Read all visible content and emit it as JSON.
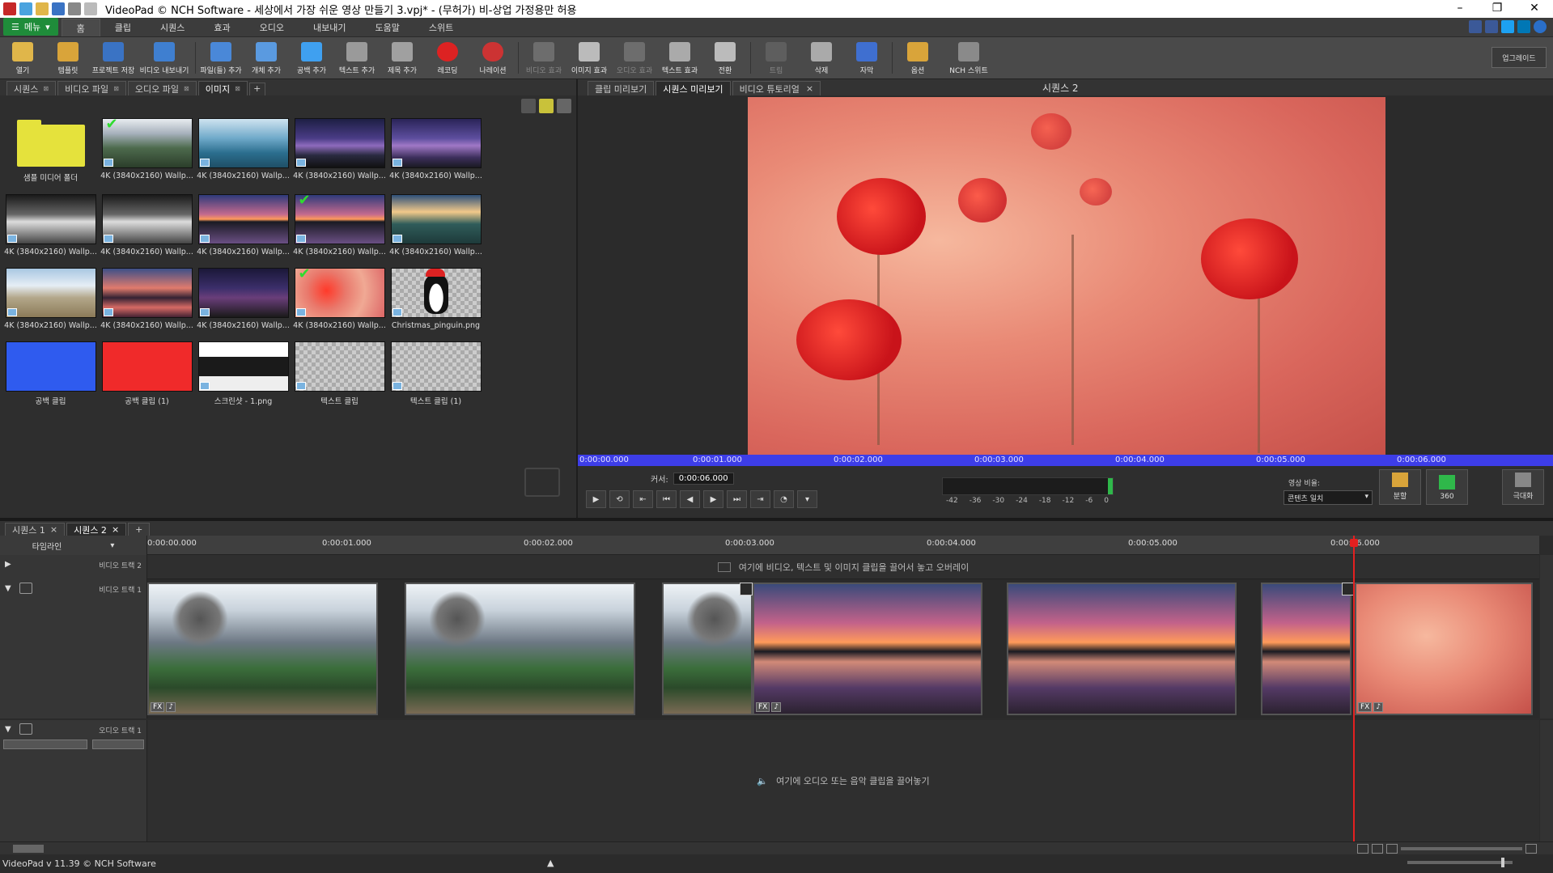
{
  "window": {
    "title": "VideoPad © NCH Software - 세상에서 가장 쉬운 영상 만들기 3.vpj* - (무허가) 비-상업 가정용만 허용",
    "minimize": "–",
    "restore": "❐",
    "close": "✕"
  },
  "menu": {
    "main_button": "메뉴",
    "tabs": [
      "홈",
      "클립",
      "시퀀스",
      "효과",
      "오디오",
      "내보내기",
      "도움말",
      "스위트"
    ]
  },
  "toolbar": {
    "items": [
      "열기",
      "템플릿",
      "프로젝트 저장",
      "비디오 내보내기",
      "파일(들) 추가",
      "개체 추가",
      "공백 추가",
      "텍스트 추가",
      "제목 추가",
      "레코딩",
      "나레이션",
      "비디오 효과",
      "이미지 효과",
      "오디오 효과",
      "텍스트 효과",
      "전환",
      "트림",
      "삭제",
      "자막",
      "옵션",
      "NCH 스위트"
    ],
    "upgrade": "업그레이드"
  },
  "bin": {
    "tabs": [
      "시퀀스",
      "비디오 파일",
      "오디오 파일",
      "이미지"
    ],
    "active_tab": "이미지",
    "plus": "+",
    "items": [
      {
        "caption": "샘플 미디어 폴더",
        "kind": "folder"
      },
      {
        "caption": "4K (3840x2160) Wallp...",
        "kind": "train",
        "checked": true
      },
      {
        "caption": "4K (3840x2160) Wallp...",
        "kind": "rock"
      },
      {
        "caption": "4K (3840x2160) Wallp...",
        "kind": "galaxy"
      },
      {
        "caption": "4K (3840x2160) Wallp...",
        "kind": "galaxy2"
      },
      {
        "caption": "4K (3840x2160) Wallp...",
        "kind": "bw"
      },
      {
        "caption": "4K (3840x2160) Wallp...",
        "kind": "bw"
      },
      {
        "caption": "4K (3840x2160) Wallp...",
        "kind": "lake"
      },
      {
        "caption": "4K (3840x2160) Wallp...",
        "kind": "lake",
        "checked": true
      },
      {
        "caption": "4K (3840x2160) Wallp...",
        "kind": "coast"
      },
      {
        "caption": "4K (3840x2160) Wallp...",
        "kind": "mountain"
      },
      {
        "caption": "4K (3840x2160) Wallp...",
        "kind": "dusk"
      },
      {
        "caption": "4K (3840x2160) Wallp...",
        "kind": "night"
      },
      {
        "caption": "4K (3840x2160) Wallp...",
        "kind": "poppy",
        "checked": true
      },
      {
        "caption": "Christmas_pinguin.png",
        "kind": "penguin"
      },
      {
        "caption": "공백 클립",
        "kind": "blue"
      },
      {
        "caption": "공백 클립 (1)",
        "kind": "red"
      },
      {
        "caption": "스크린샷 - 1.png",
        "kind": "screenshot"
      },
      {
        "caption": "텍스트 클립",
        "kind": "text"
      },
      {
        "caption": "텍스트 클립 (1)",
        "kind": "text"
      }
    ]
  },
  "preview": {
    "tabs": [
      "클립 미리보기",
      "시퀀스 미리보기",
      "비디오 튜토리얼"
    ],
    "active_tab": "시퀀스 미리보기",
    "sequence_name": "시퀀스 2",
    "time_marks": [
      "0:00:00.000",
      "0:00:01.000",
      "0:00:02.000",
      "0:00:03.000",
      "0:00:04.000",
      "0:00:05.000",
      "0:00:06.000"
    ],
    "cursor_label": "커서:",
    "cursor_value": "0:00:06.000",
    "meter_scale": [
      "-42",
      "-36",
      "-30",
      "-24",
      "-18",
      "-12",
      "-6",
      "0"
    ],
    "ratio_label": "영상 비율:",
    "ratio_value": "콘텐츠 일치",
    "split_label": "분할",
    "view360_label": "360",
    "fullscreen_label": "극대화"
  },
  "timeline": {
    "seq_tabs": [
      "시퀀스 1",
      "시퀀스 2"
    ],
    "active_seq": "시퀀스 2",
    "plus": "+",
    "timeline_label": "타임라인",
    "ruler": [
      "0:00:00.000",
      "0:00:01.000",
      "0:00:02.000",
      "0:00:03.000",
      "0:00:04.000",
      "0:00:05.000",
      "0:00:06.000"
    ],
    "overlay_hint": "여기에 비디오, 텍스트 및 이미지 클립을 끌어서 놓고 오버레이",
    "video_track2": "비디오 트랙 2",
    "video_track1": "비디오 트랙 1",
    "audio_track1": "오디오 트랙 1",
    "audio_hint": "여기에 오디오 또는 음악 클립을 끌어놓기",
    "fx": "FX"
  },
  "status": {
    "text": "VideoPad v 11.39 © NCH Software"
  },
  "colors": {
    "accent_green": "#1f8c3a",
    "timebar_blue": "#3d3de8",
    "playhead_red": "#e32020"
  }
}
